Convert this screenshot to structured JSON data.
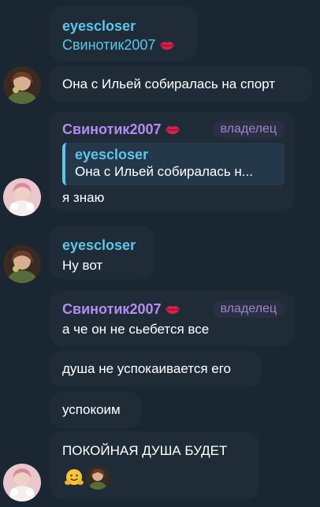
{
  "messages": [
    {
      "sender": "eyescloser",
      "subtitle": "Свинотик2007",
      "sticker": "lips-emoji"
    },
    {
      "text": "Она с Ильей собиралась на спорт"
    },
    {
      "sender": "Свинотик2007",
      "badge": "владелец",
      "quote_sender": "eyescloser",
      "quote_text": "Она с Ильей собиралась н...",
      "text": "я знаю"
    },
    {
      "sender": "eyescloser",
      "text": "Ну вот"
    },
    {
      "sender": "Свинотик2007",
      "badge": "владелец",
      "text": "а че он не сьебется все"
    },
    {
      "text": "душа не успокаивается его"
    },
    {
      "text": "успокоим"
    },
    {
      "text": "ПОКОЙНАЯ ДУША БУДЕТ",
      "reactions": [
        "hugging-face-emoji",
        "user-avatar-reaction"
      ]
    }
  ],
  "colors": {
    "background": "#1a2632",
    "bubble": "#1f2c38",
    "name_cyan": "#5ec6e8",
    "name_purple": "#b48cf0",
    "badge_text": "#9b87c9"
  }
}
